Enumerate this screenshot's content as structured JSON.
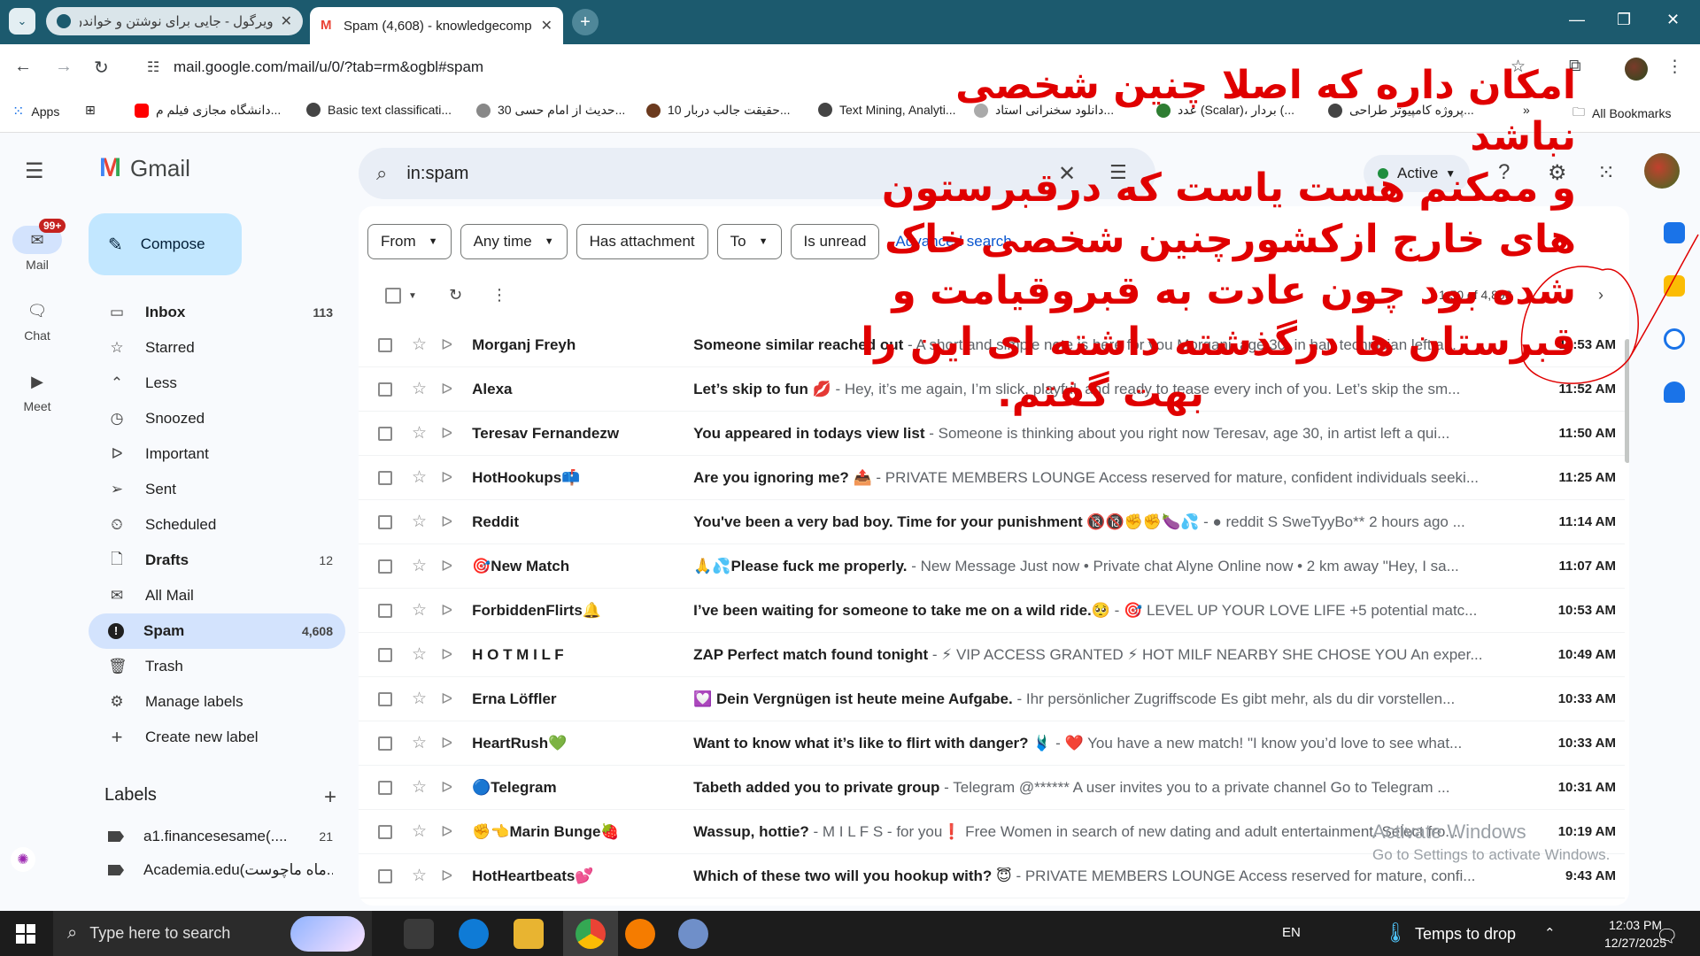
{
  "browser": {
    "tabs": [
      {
        "title": "ویرگول - جایی برای نوشتن و خواندن",
        "active": false
      },
      {
        "title": "Spam (4,608) - knowledgecomp",
        "active": true
      }
    ],
    "url": "mail.google.com/mail/u/0/?tab=rm&ogbl#spam",
    "bookmarks": [
      {
        "label": "Apps"
      },
      {
        "label": "دانشگاه مجازی فیلم م..."
      },
      {
        "label": "Basic text classificati..."
      },
      {
        "label": "30 حدیث از امام حسی..."
      },
      {
        "label": "10 حقیقت جالب دربار..."
      },
      {
        "label": "Text Mining, Analyti..."
      },
      {
        "label": "دانلود سخنرانی استاد..."
      },
      {
        "label": "عدد (Scalar)، بردار (..."
      },
      {
        "label": "پروژه کامپیوتر طراحی..."
      },
      {
        "label": "All Bookmarks"
      }
    ]
  },
  "gmail": {
    "brand": "Gmail",
    "rail": [
      {
        "label": "Mail",
        "badge": "99+"
      },
      {
        "label": "Chat"
      },
      {
        "label": "Meet"
      }
    ],
    "compose_label": "Compose",
    "nav": [
      {
        "label": "Inbox",
        "count": "113",
        "icon": "inbox-icon",
        "glyph": "▭"
      },
      {
        "label": "Starred",
        "count": "",
        "icon": "star-icon",
        "glyph": "☆"
      },
      {
        "label": "Less",
        "count": "",
        "icon": "chevron-up-icon",
        "glyph": "⌃"
      },
      {
        "label": "Snoozed",
        "count": "",
        "icon": "clock-icon",
        "glyph": "◷"
      },
      {
        "label": "Important",
        "count": "",
        "icon": "important-icon",
        "glyph": "ᐅ"
      },
      {
        "label": "Sent",
        "count": "",
        "icon": "send-icon",
        "glyph": "➢"
      },
      {
        "label": "Scheduled",
        "count": "",
        "icon": "scheduled-icon",
        "glyph": "⏲"
      },
      {
        "label": "Drafts",
        "count": "12",
        "icon": "draft-icon",
        "glyph": "🗋"
      },
      {
        "label": "All Mail",
        "count": "",
        "icon": "all-mail-icon",
        "glyph": "✉"
      },
      {
        "label": "Spam",
        "count": "4,608",
        "icon": "spam-icon",
        "glyph": "!"
      },
      {
        "label": "Trash",
        "count": "",
        "icon": "trash-icon",
        "glyph": "🗑"
      },
      {
        "label": "Manage labels",
        "count": "",
        "icon": "gear-icon",
        "glyph": "⚙"
      },
      {
        "label": "Create new label",
        "count": "",
        "icon": "plus-icon",
        "glyph": "+"
      }
    ],
    "labels_title": "Labels",
    "labels": [
      {
        "name": "a1.financesesame(....",
        "count": "21"
      },
      {
        "name": "Academia.edu(ماه ماچوست...",
        "count": ""
      }
    ],
    "search": {
      "query": "in:spam"
    },
    "status": "Active",
    "filters": [
      "From",
      "Any time",
      "Has attachment",
      "To",
      "Is unread"
    ],
    "advanced_search": "Advanced search",
    "page_info": "1-50 of 4,898",
    "emails": [
      {
        "sender": "Morganj Freyh",
        "subject": "Someone similar reached out",
        "snippet": " - A short and simple note is here for you Morganj, age 30, in hair technician left a...",
        "time": "11:53 AM"
      },
      {
        "sender": "Alexa",
        "subject": "Let’s skip to fun 💋",
        "snippet": " - Hey, it’s me again, I’m slick, playful, and ready to tease every inch of you. Let’s skip the sm...",
        "time": "11:52 AM"
      },
      {
        "sender": "Teresav Fernandezw",
        "subject": "You appeared in todays view list",
        "snippet": " - Someone is thinking about you right now Teresav, age 30, in artist left a qui...",
        "time": "11:50 AM"
      },
      {
        "sender": "HotHookups📫",
        "subject": "Are you ignoring me? 📤",
        "snippet": " - PRIVATE MEMBERS LOUNGE Access reserved for mature, confident individuals seeki...",
        "time": "11:25 AM"
      },
      {
        "sender": "Reddit",
        "subject": "You've been a very bad boy. Time for your punishment 🔞🔞✊✊🍆💦",
        "snippet": " - ● reddit S SweTyyBo** 2 hours ago ...",
        "time": "11:14 AM"
      },
      {
        "sender": "🎯New Match",
        "subject": "🙏💦Please fuck me properly.",
        "snippet": " - New Message Just now • Private chat Alyne Online now • 2 km away \"Hey, I sa...",
        "time": "11:07 AM"
      },
      {
        "sender": "ForbiddenFlirts🔔",
        "subject": "I’ve been waiting for someone to take me on a wild ride.🥺",
        "snippet": " - 🎯 LEVEL UP YOUR LOVE LIFE +5 potential matc...",
        "time": "10:53 AM"
      },
      {
        "sender": "H O T M I L F",
        "subject": "ZAP Perfect match found tonight",
        "snippet": " - ⚡ VIP ACCESS GRANTED ⚡ HOT MILF NEARBY SHE CHOSE YOU An exper...",
        "time": "10:49 AM"
      },
      {
        "sender": "Erna Löffler",
        "subject": "💟 Dein Vergnügen ist heute meine Aufgabe.",
        "snippet": " - Ihr persönlicher Zugriffscode Es gibt mehr, als du dir vorstellen...",
        "time": "10:33 AM"
      },
      {
        "sender": "HeartRush💚",
        "subject": "Want to know what it’s like to flirt with danger? 🩱",
        "snippet": " - ❤️ You have a new match! \"I know you’d love to see what...",
        "time": "10:33 AM"
      },
      {
        "sender": "🔵Telegram",
        "subject": "Tabeth added you to private group",
        "snippet": " - Telegram @****** A user invites you to a private channel Go to Telegram ...",
        "time": "10:31 AM"
      },
      {
        "sender": "✊👈Marin Bunge🍓",
        "subject": "Wassup, hottie?",
        "snippet": " - M I L F S - for you❗ Free Women in search of new dating and adult entertainment. Select fro...",
        "time": "10:19 AM"
      },
      {
        "sender": "HotHeartbeats💕",
        "subject": "Which of these two will you hookup with? 😇",
        "snippet": " - PRIVATE MEMBERS LOUNGE Access reserved for mature, confi...",
        "time": "9:43 AM"
      }
    ],
    "watermark": [
      "Activate Windows",
      "Go to Settings to activate Windows."
    ]
  },
  "annotation": {
    "lines": [
      "امکان داره که اصلا چنین شخصی نباشد",
      "و ممکنم هست یاست که درقبرستون",
      "های خارج ازکشورچنین شخصی خاک",
      "شده بود چون عادت به قبروقیامت و",
      "قبرستان ها درگذشته داشته ای این را",
      "بهت گفتم."
    ],
    "color": "#e00000"
  },
  "taskbar": {
    "search_placeholder": "Type here to search",
    "lang": "EN",
    "weather": "Temps to drop",
    "time": "12:03 PM",
    "date": "12/27/2025"
  },
  "colors": {
    "accent": "#0b57d0",
    "spam_active": "#d3e3fd",
    "compose": "#c2e7ff",
    "chrome": "#1c5a6e"
  }
}
